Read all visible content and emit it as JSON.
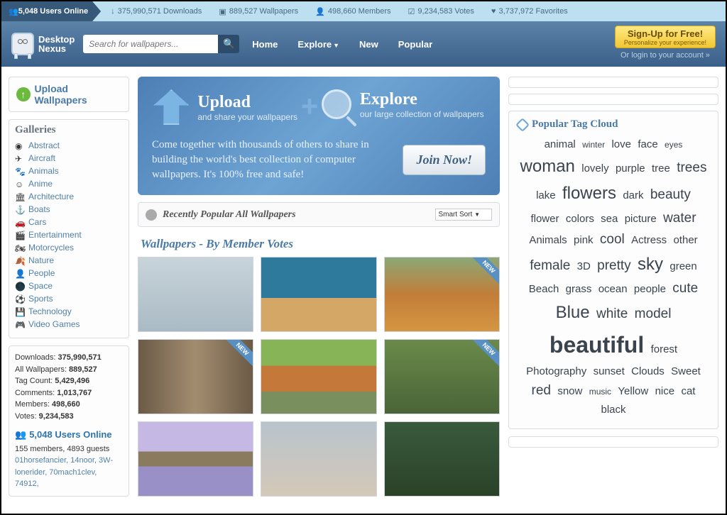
{
  "topbar": {
    "users_online": "5,048 Users Online",
    "stats": [
      {
        "icon": "↓",
        "text": "375,990,571 Downloads"
      },
      {
        "icon": "▣",
        "text": "889,527 Wallpapers"
      },
      {
        "icon": "👤",
        "text": "498,660 Members"
      },
      {
        "icon": "☑",
        "text": "9,234,583 Votes"
      },
      {
        "icon": "♥",
        "text": "3,737,972 Favorites"
      }
    ]
  },
  "brand": {
    "line1": "Desktop",
    "line2": "Nexus"
  },
  "search": {
    "placeholder": "Search for wallpapers..."
  },
  "nav": {
    "home": "Home",
    "explore": "Explore",
    "new": "New",
    "popular": "Popular"
  },
  "signup": {
    "title": "Sign-Up for Free!",
    "sub": "Personalize your experience!",
    "login": "Or login to your account »"
  },
  "upload_btn": "Upload Wallpapers",
  "galleries": {
    "title": "Galleries",
    "items": [
      "Abstract",
      "Aircraft",
      "Animals",
      "Anime",
      "Architecture",
      "Boats",
      "Cars",
      "Entertainment",
      "Motorcycles",
      "Nature",
      "People",
      "Space",
      "Sports",
      "Technology",
      "Video Games"
    ]
  },
  "stats_box": {
    "lines": [
      {
        "k": "Downloads:",
        "v": "375,990,571"
      },
      {
        "k": "All Wallpapers:",
        "v": "889,527"
      },
      {
        "k": "Tag Count:",
        "v": "5,429,496"
      },
      {
        "k": "Comments:",
        "v": "1,013,767"
      },
      {
        "k": "Members:",
        "v": "498,660"
      },
      {
        "k": "Votes:",
        "v": "9,234,583"
      }
    ],
    "online_head": "5,048 Users Online",
    "online_detail": "155 members, 4893 guests",
    "users": "01horsefancier, 14noor, 3W-lonerider, 70mach1clev, 74912,"
  },
  "hero": {
    "upload": {
      "h": "Upload",
      "p": "and share your wallpapers"
    },
    "explore": {
      "h": "Explore",
      "p": "our large collection of wallpapers"
    },
    "text": "Come together with thousands of others to share in building the world's best collection of computer wallpapers. It's 100% free and safe!",
    "join": "Join Now!"
  },
  "recent": {
    "title": "Recently Popular All Wallpapers",
    "sort": "Smart Sort"
  },
  "votes_head": "Wallpapers - By Member Votes",
  "thumbs": [
    {
      "bg": "linear-gradient(#c8d4da,#aabac4)",
      "new": false
    },
    {
      "bg": "linear-gradient(#2e7a9c 55%,#d4a766 55%)",
      "new": false
    },
    {
      "bg": "linear-gradient(#8ba876,#c27d38,#d49642)",
      "new": true
    },
    {
      "bg": "linear-gradient(90deg,#6b5a46,#a38d70,#6b5a46)",
      "new": true
    },
    {
      "bg": "linear-gradient(#87b456 35%,#c4783a 35% 70%,#7a8f5e 70%)",
      "new": false
    },
    {
      "bg": "linear-gradient(#6a8a4a,#4a6438)",
      "new": true
    },
    {
      "bg": "linear-gradient(#c5b8e4 40%,#8a7a5e 40% 60%,#9a90c8 60%)",
      "new": false
    },
    {
      "bg": "linear-gradient(#b8c4cc,#d4c8b8)",
      "new": false
    },
    {
      "bg": "linear-gradient(#3a5a3c,#2a4228)",
      "new": false
    }
  ],
  "tagcloud": {
    "title": "Popular Tag Cloud",
    "tags": [
      {
        "t": "animal",
        "s": 2
      },
      {
        "t": "winter",
        "s": 1
      },
      {
        "t": "love",
        "s": 2
      },
      {
        "t": "face",
        "s": 2
      },
      {
        "t": "eyes",
        "s": 1
      },
      {
        "t": "woman",
        "s": 4
      },
      {
        "t": "lovely",
        "s": 2
      },
      {
        "t": "purple",
        "s": 2
      },
      {
        "t": "tree",
        "s": 2
      },
      {
        "t": "trees",
        "s": 3
      },
      {
        "t": "lake",
        "s": 2
      },
      {
        "t": "flowers",
        "s": 4
      },
      {
        "t": "dark",
        "s": 2
      },
      {
        "t": "beauty",
        "s": 3
      },
      {
        "t": "flower",
        "s": 2
      },
      {
        "t": "colors",
        "s": 2
      },
      {
        "t": "sea",
        "s": 2
      },
      {
        "t": "picture",
        "s": 2
      },
      {
        "t": "water",
        "s": 3
      },
      {
        "t": "Animals",
        "s": 2
      },
      {
        "t": "pink",
        "s": 2
      },
      {
        "t": "cool",
        "s": 3
      },
      {
        "t": "Actress",
        "s": 2
      },
      {
        "t": "other",
        "s": 2
      },
      {
        "t": "female",
        "s": 3
      },
      {
        "t": "3D",
        "s": 2
      },
      {
        "t": "pretty",
        "s": 3
      },
      {
        "t": "sky",
        "s": 4
      },
      {
        "t": "green",
        "s": 2
      },
      {
        "t": "Beach",
        "s": 2
      },
      {
        "t": "grass",
        "s": 2
      },
      {
        "t": "ocean",
        "s": 2
      },
      {
        "t": "people",
        "s": 2
      },
      {
        "t": "cute",
        "s": 3
      },
      {
        "t": "Blue",
        "s": 4
      },
      {
        "t": "white",
        "s": 3
      },
      {
        "t": "model",
        "s": 3
      },
      {
        "t": "beautiful",
        "s": 5
      },
      {
        "t": "forest",
        "s": 2
      },
      {
        "t": "Photography",
        "s": 2
      },
      {
        "t": "sunset",
        "s": 2
      },
      {
        "t": "Clouds",
        "s": 2
      },
      {
        "t": "Sweet",
        "s": 2
      },
      {
        "t": "red",
        "s": 3
      },
      {
        "t": "snow",
        "s": 2
      },
      {
        "t": "music",
        "s": 1
      },
      {
        "t": "Yellow",
        "s": 2
      },
      {
        "t": "nice",
        "s": 2
      },
      {
        "t": "cat",
        "s": 2
      },
      {
        "t": "black",
        "s": 2
      }
    ]
  },
  "new_badge": "NEW"
}
